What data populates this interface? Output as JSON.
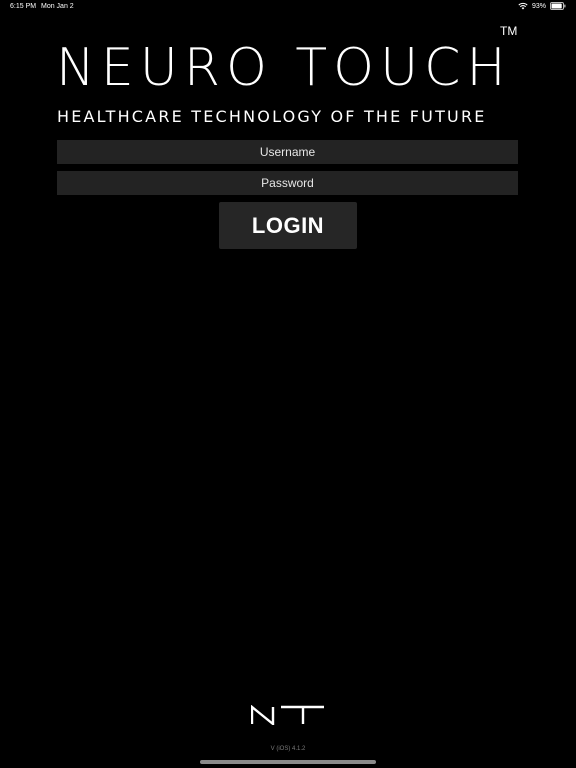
{
  "status_bar": {
    "time": "6:15 PM",
    "date": "Mon Jan 2",
    "battery_percent": "93%",
    "battery_level": 0.93,
    "wifi_icon": "wifi-icon",
    "battery_icon": "battery-icon"
  },
  "brand": {
    "title": "NEURO TOUCH",
    "trademark": "TM",
    "tagline": "HEALTHCARE TECHNOLOGY OF THE FUTURE"
  },
  "login_form": {
    "username_placeholder": "Username",
    "username_value": "",
    "password_placeholder": "Password",
    "password_value": "",
    "login_label": "LOGIN"
  },
  "footer": {
    "logo_icon": "nt-logo-icon",
    "version": "V (iOS) 4.1.2"
  },
  "colors": {
    "background": "#000000",
    "field_background": "#232323",
    "button_background": "#262626",
    "text": "#ffffff",
    "muted_text": "#7a7a7a"
  }
}
